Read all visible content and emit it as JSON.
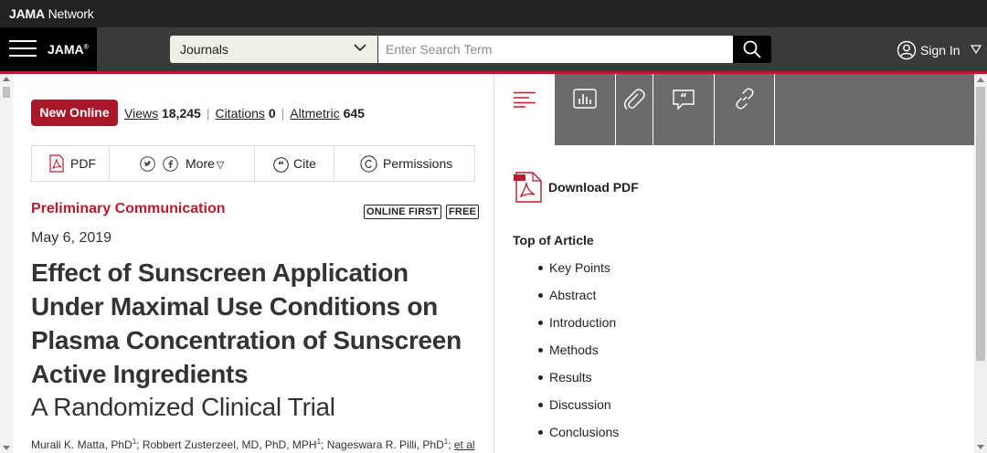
{
  "network": {
    "brand_bold": "JAMA",
    "brand_rest": " Network"
  },
  "header": {
    "menu_icon": "hamburger-menu-icon",
    "logo": "JAMA",
    "logo_mark": "®",
    "journals_label": "Journals",
    "search_placeholder": "Enter Search Term",
    "search_icon": "search-icon",
    "signin_label": "Sign In",
    "signin_icon": "user-circle-icon"
  },
  "article": {
    "badge": "New Online",
    "metrics": {
      "views_label": "Views",
      "views_value": "18,245",
      "citations_label": "Citations",
      "citations_value": "0",
      "altmetric_label": "Altmetric",
      "altmetric_value": "645"
    },
    "toolbar": {
      "pdf": "PDF",
      "more": "More",
      "more_caret": "▽",
      "cite": "Cite",
      "permissions": "Permissions"
    },
    "section": "Preliminary Communication",
    "tags": [
      "ONLINE FIRST",
      "FREE"
    ],
    "date": "May 6, 2019",
    "title": "Effect of Sunscreen Application Under Maximal Use Conditions on Plasma Concentration of Sunscreen Active Ingredients",
    "subtitle": "A Randomized Clinical Trial",
    "authors": [
      {
        "name": "Murali K. Matta, PhD",
        "sup": "1"
      },
      {
        "name": "Robbert Zusterzeel, MD, PhD, MPH",
        "sup": "1"
      },
      {
        "name": "Nageswara R. Pilli, PhD",
        "sup": "1"
      }
    ],
    "et_al": "et al"
  },
  "sidepanel": {
    "tabs": [
      "outline-icon",
      "figures-icon",
      "attachment-icon",
      "comments-icon",
      "related-links-icon"
    ],
    "download_pdf": "Download PDF",
    "toc_heading": "Top of Article",
    "toc_items": [
      "Key Points",
      "Abstract",
      "Introduction",
      "Methods",
      "Results",
      "Discussion",
      "Conclusions"
    ]
  },
  "colors": {
    "accent": "#c0182d",
    "badge": "#a6182a",
    "header": "#3a3a3a",
    "tabs": "#6b6b6b"
  }
}
